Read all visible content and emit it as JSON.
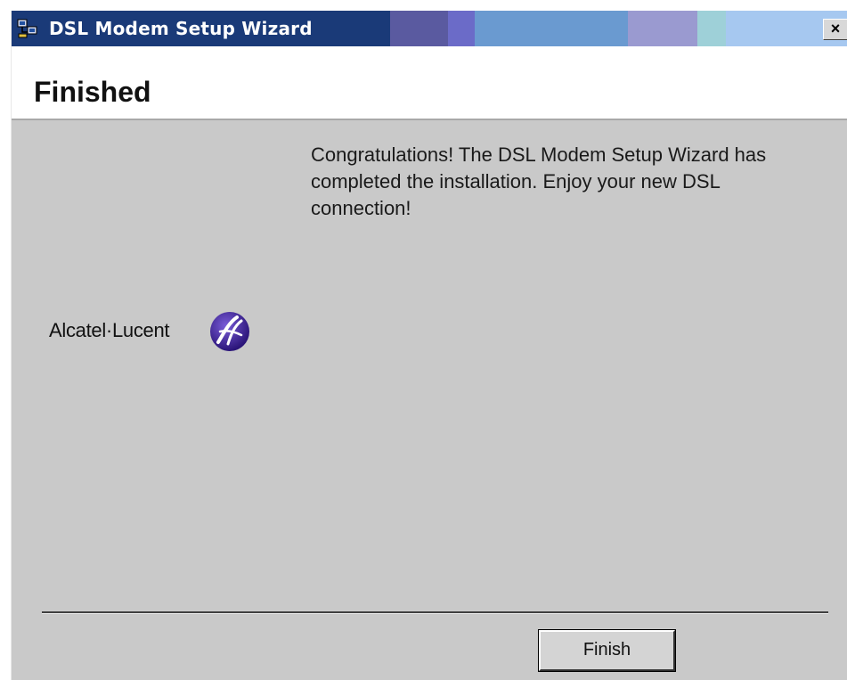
{
  "window": {
    "title": "DSL Modem Setup Wizard",
    "close_label": "×"
  },
  "header": {
    "title": "Finished"
  },
  "content": {
    "message": "Congratulations!  The DSL Modem Setup Wizard has completed the installation.  Enjoy your new DSL connection!"
  },
  "logo": {
    "text": "Alcatel·Lucent"
  },
  "footer": {
    "finish_label": "Finish"
  },
  "colors": {
    "titlebar": "#6f90c8",
    "dialog_background": "#c9c9c9",
    "logo_mark": "#3a1f86"
  }
}
